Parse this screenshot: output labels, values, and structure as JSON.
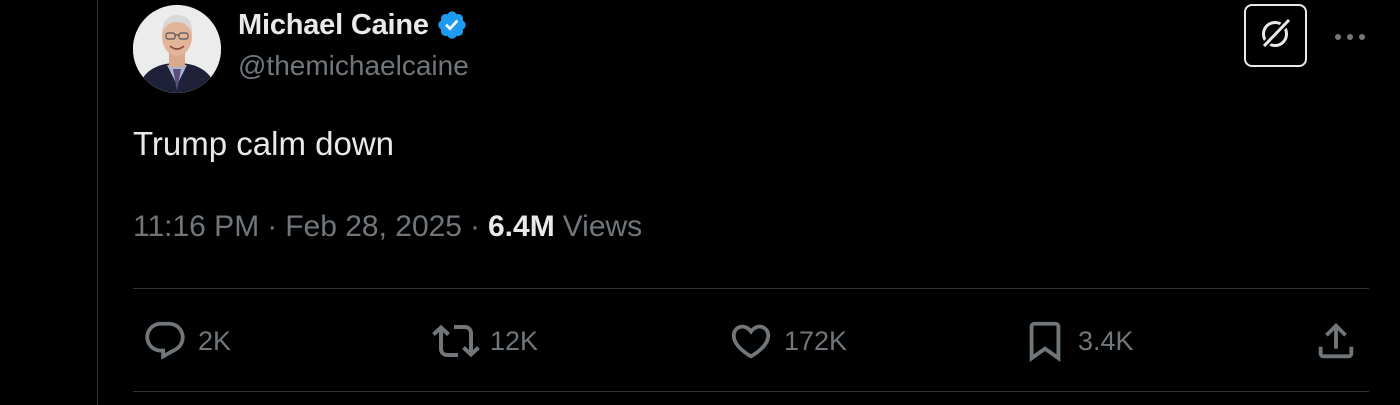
{
  "author": {
    "display_name": "Michael Caine",
    "handle": "@themichaelcaine",
    "verified": true
  },
  "tweet": {
    "text": "Trump calm down",
    "time": "11:16 PM",
    "date": "Feb 28, 2025",
    "separator": "·",
    "views_count": "6.4M",
    "views_label": "Views"
  },
  "actions": {
    "replies": "2K",
    "reposts": "12K",
    "likes": "172K",
    "bookmarks": "3.4K"
  },
  "icons": {
    "verified": "verified-badge-icon",
    "grok": "grok-icon",
    "more": "more-icon",
    "reply": "reply-icon",
    "repost": "repost-icon",
    "like": "heart-icon",
    "bookmark": "bookmark-icon",
    "share": "share-icon"
  },
  "colors": {
    "background": "#000000",
    "text_primary": "#e7e9ea",
    "text_secondary": "#71767b",
    "divider": "#2f3336",
    "verified_blue": "#1d9bf0"
  }
}
